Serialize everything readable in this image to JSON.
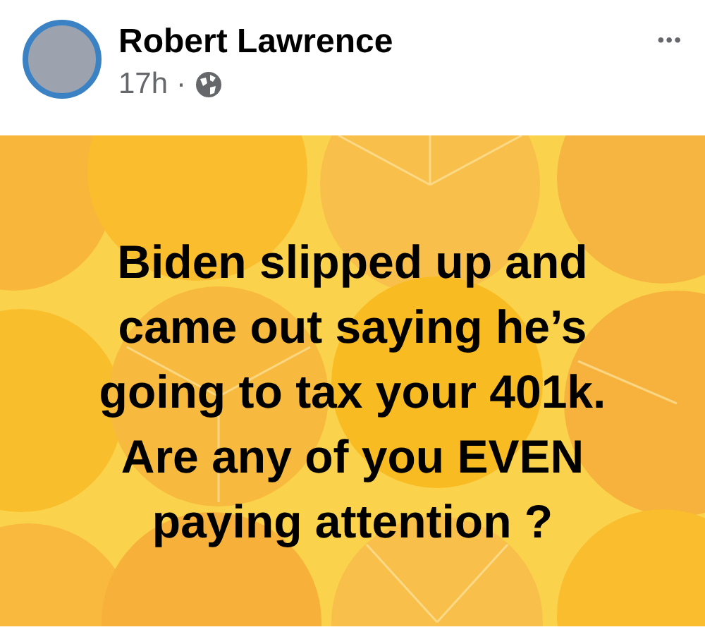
{
  "post": {
    "author": "Robert Lawrence",
    "time": "17h",
    "separator": "·",
    "more": "•••",
    "lines": [
      "Biden slipped up and",
      "came out saying he’s",
      "going to tax your 401k.",
      "Are any of you EVEN",
      "paying attention ?"
    ]
  }
}
